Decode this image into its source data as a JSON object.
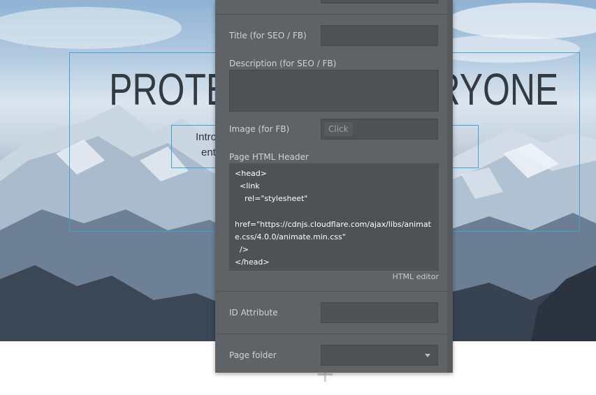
{
  "canvas": {
    "headline_left": "PROTEC",
    "headline_right": "RYONE",
    "intro_line1": "Intro",
    "intro_line2": "ent",
    "add_symbol": "+"
  },
  "panel": {
    "title_label": "Title (for SEO / FB)",
    "title_value": "",
    "description_label": "Description (for SEO / FB)",
    "description_value": "",
    "image_label": "Image (for FB)",
    "image_button": "Click",
    "header_label": "Page HTML Header",
    "header_code": "<head>\n  <link\n    rel=\"stylesheet\"\n\nhref=\"https://cdnjs.cloudflare.com/ajax/libs/animate.css/4.0.0/animate.min.css\"\n  />\n</head>",
    "html_editor_link": "HTML editor",
    "id_label": "ID Attribute",
    "id_value": "",
    "folder_label": "Page folder",
    "folder_value": ""
  },
  "colors": {
    "panel_bg": "#5f6366",
    "field_bg": "#4e5255",
    "selection_outline": "#3ea3d0"
  }
}
